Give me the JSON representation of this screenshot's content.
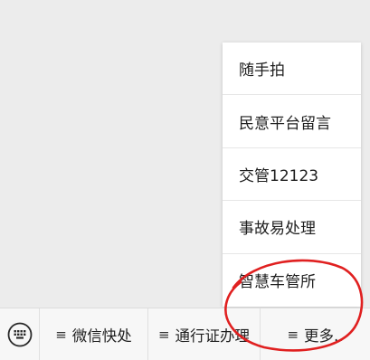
{
  "popup_menu": {
    "items": [
      {
        "label": "随手拍"
      },
      {
        "label": "民意平台留言"
      },
      {
        "label": "交管12123"
      },
      {
        "label": "事故易处理"
      },
      {
        "label": "智慧车管所"
      }
    ]
  },
  "bottom_bar": {
    "keyboard_icon": "keyboard-icon",
    "tabs": [
      {
        "label": "微信快处",
        "icon": "hamburger-icon"
      },
      {
        "label": "通行证办理",
        "icon": "hamburger-icon"
      },
      {
        "label": "更多..",
        "icon": "hamburger-icon"
      }
    ]
  },
  "colors": {
    "background": "#ececec",
    "menu_background": "#ffffff",
    "annotation": "#e02020"
  }
}
